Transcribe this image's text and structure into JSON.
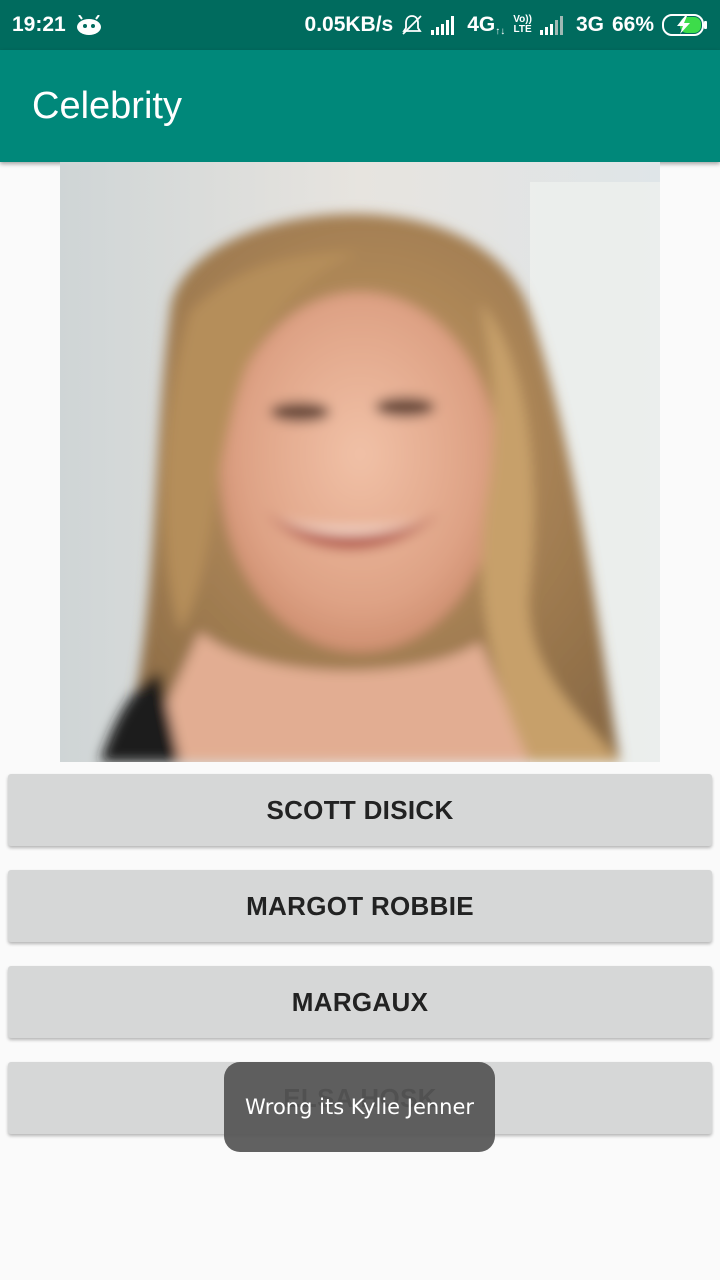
{
  "status_bar": {
    "time": "19:21",
    "network_speed": "0.05KB/s",
    "network_type_1": "4G",
    "network_type_1_suffix": "↑↓",
    "volte_top": "Vo))",
    "volte_bottom": "LTE",
    "network_type_2": "3G",
    "battery_percent": "66%",
    "icons": [
      "android-icon",
      "mute-bell-icon",
      "signal-icon",
      "signal-icon",
      "battery-charging-icon"
    ],
    "background": "#006b5e"
  },
  "app_bar": {
    "title": "Celebrity",
    "background": "#00887a"
  },
  "photo": {
    "semantic": "celebrity-photo",
    "description_hint": "portrait photo"
  },
  "answers": [
    {
      "label": "SCOTT DISICK"
    },
    {
      "label": "MARGOT ROBBIE"
    },
    {
      "label": "MARGAUX"
    },
    {
      "label": "ELSA HOSK"
    }
  ],
  "toast": {
    "message": "Wrong its Kylie Jenner"
  },
  "colors": {
    "button_bg": "#d6d7d7",
    "button_text": "#222222",
    "page_bg": "#fafafa"
  }
}
